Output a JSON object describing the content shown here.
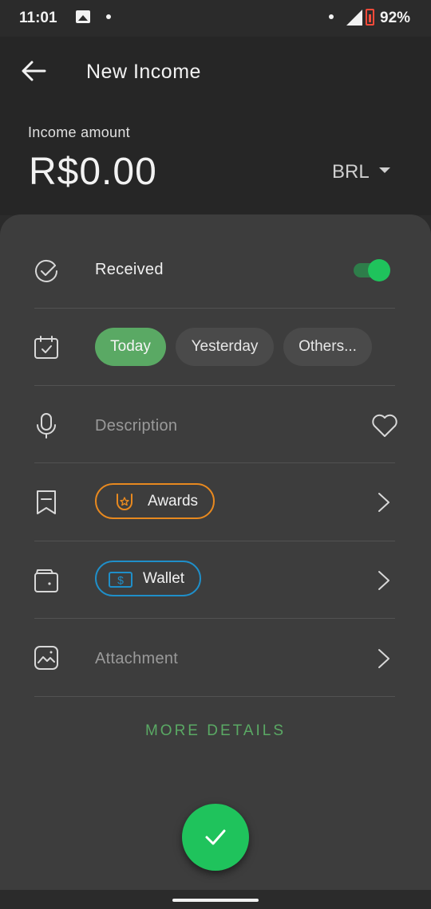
{
  "status_bar": {
    "time": "11:01",
    "battery": "92%",
    "icons": [
      "gallery-icon",
      "notification-dot",
      "signal-icon",
      "battery-icon"
    ]
  },
  "header": {
    "title": "New Income",
    "amount_label": "Income amount",
    "amount": "R$0.00",
    "currency": "BRL"
  },
  "form": {
    "received": {
      "label": "Received",
      "toggle_on": true
    },
    "date": {
      "options": [
        "Today",
        "Yesterday",
        "Others..."
      ],
      "selected": "Today"
    },
    "description": {
      "placeholder": "Description"
    },
    "category": {
      "label": "Awards",
      "color": "#e8891f"
    },
    "account": {
      "label": "Wallet",
      "color": "#1f8fc9"
    },
    "attachment": {
      "placeholder": "Attachment"
    },
    "more_details": "MORE DETAILS"
  },
  "colors": {
    "accent": "#5aa964",
    "fab": "#1fc35c",
    "sheet": "#3d3d3d",
    "header": "#262626"
  }
}
